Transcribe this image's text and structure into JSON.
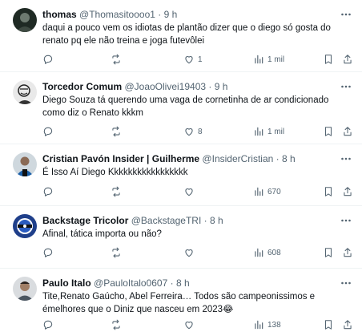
{
  "tweets": [
    {
      "name": "thomas",
      "handle": "@Thomasitoooo1",
      "dot": "·",
      "time": "9 h",
      "text_lines": [
        "daqui a pouco vem os idiotas de plantão dizer que o diego só gosta do",
        "renato pq ele não treina e joga futevôlei"
      ],
      "reply_count": "",
      "retweet_count": "",
      "like_count": "1",
      "view_count": "1 mil",
      "avatar": "avatar-photo-dark"
    },
    {
      "name": "Torcedor Comum",
      "handle": "@JoaoOlivei19403",
      "dot": "·",
      "time": "9 h",
      "text_lines": [
        "Diego Souza tá querendo uma vaga de cornetinha de ar condicionado",
        "como diz o Renato kkkm"
      ],
      "reply_count": "",
      "retweet_count": "",
      "like_count": "8",
      "view_count": "1 mil",
      "avatar": "avatar-photo-sketch"
    },
    {
      "name": "Cristian Pavón Insider | Guilherme",
      "handle": "@InsiderCristian",
      "dot": "·",
      "time": "8 h",
      "text_lines": [
        "É Isso Aí Diego Kkkkkkkkkkkkkkkkk"
      ],
      "reply_count": "",
      "retweet_count": "",
      "like_count": "",
      "view_count": "670",
      "avatar": "avatar-photo-player"
    },
    {
      "name": "Backstage Tricolor",
      "handle": "@BackstageTRI",
      "dot": "·",
      "time": "8 h",
      "text_lines": [
        "Afinal, tática importa ou não?"
      ],
      "reply_count": "",
      "retweet_count": "",
      "like_count": "",
      "view_count": "608",
      "avatar": "avatar-logo-backstage"
    },
    {
      "name": "Paulo Italo",
      "handle": "@PauloItalo0607",
      "dot": "·",
      "time": "8 h",
      "text_lines": [
        "Tite,Renato Gaúcho, Abel Ferreira… Todos são campeonissimos e",
        "émelhores que o Diniz que nasceu em 2023😂"
      ],
      "reply_count": "",
      "retweet_count": "",
      "like_count": "",
      "view_count": "138",
      "avatar": "avatar-photo-person"
    }
  ],
  "icons": {
    "more": "more-icon",
    "reply": "reply-icon",
    "retweet": "retweet-icon",
    "like": "like-icon",
    "views": "views-icon",
    "bookmark": "bookmark-icon",
    "share": "share-icon"
  },
  "colors": {
    "text": "#0f1419",
    "secondary": "#536471",
    "divider": "#eff3f4"
  }
}
